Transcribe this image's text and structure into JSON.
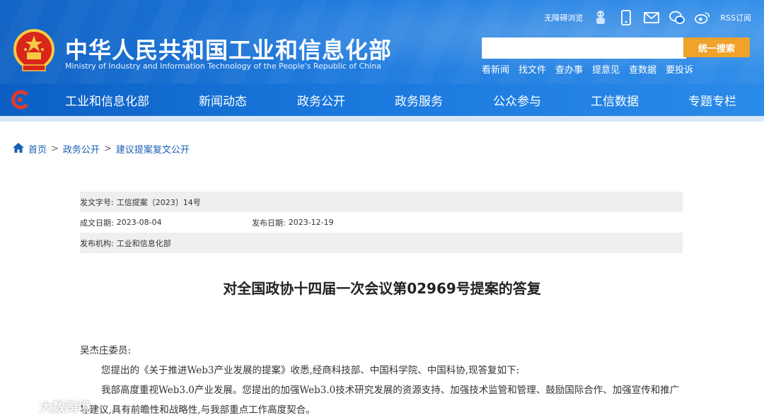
{
  "header": {
    "site_title": "中华人民共和国工业和信息化部",
    "site_subtitle": "Ministry of Industry and Information Technology of the People's Republic of China",
    "accessibility_label": "无障碍浏览",
    "rss_label": "RSS订阅",
    "search": {
      "placeholder": "",
      "button_label": "统一搜索"
    },
    "quick_links": [
      "看新闻",
      "找文件",
      "查办事",
      "提意见",
      "查数据",
      "要投诉"
    ]
  },
  "nav": {
    "items": [
      "工业和信息化部",
      "新闻动态",
      "政务公开",
      "政务服务",
      "公众参与",
      "工信数据",
      "专题专栏"
    ]
  },
  "breadcrumb": {
    "home": "首页",
    "items": [
      "政务公开",
      "建议提案复文公开"
    ],
    "separator": ">"
  },
  "meta": {
    "doc_no_label": "发文字号:",
    "doc_no": "工信提案〔2023〕14号",
    "created_label": "成文日期:",
    "created": "2023-08-04",
    "published_label": "发布日期:",
    "published": "2023-12-19",
    "issuer_label": "发布机构:",
    "issuer": "工业和信息化部"
  },
  "document": {
    "title": "对全国政协十四届一次会议第02969号提案的答复",
    "salutation": "吴杰庄委员:",
    "paragraphs": [
      "您提出的《关于推进Web3产业发展的提案》收悉,经商科技部、中国科学院、中国科协,现答复如下:",
      "我部高度重视Web3.0产业发展。您提出的加强Web3.0技术研究发展的资源支持、加强技术监管和管理、鼓励国际合作、加强宣传和推广等建议,具有前瞻性和战略性,与我部重点工作高度契合。"
    ]
  },
  "watermark": {
    "text": "大数跨境"
  },
  "colors": {
    "header_blue": "#1a78dd",
    "search_button": "#f1a22a",
    "link_blue": "#1a5fb4",
    "meta_shade": "#efefef"
  }
}
